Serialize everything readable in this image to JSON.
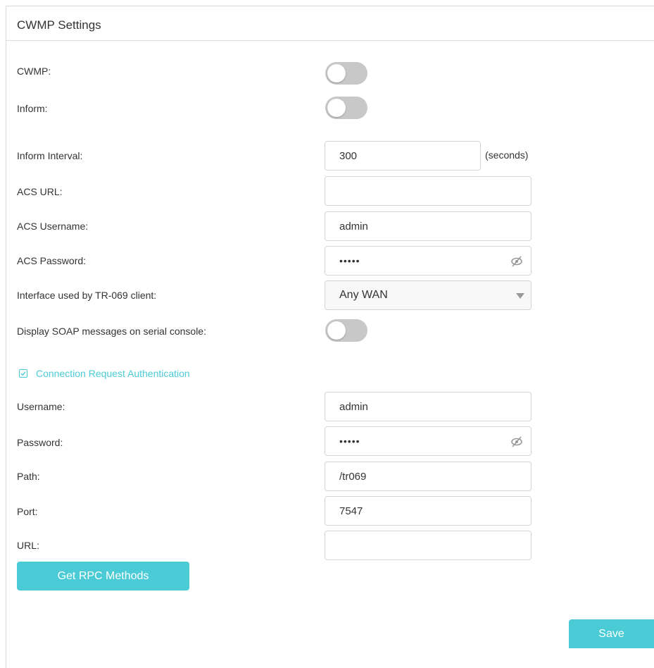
{
  "panel": {
    "title": "CWMP Settings"
  },
  "cwmp": {
    "label": "CWMP:",
    "enabled": false
  },
  "inform": {
    "label": "Inform:",
    "enabled": false
  },
  "inform_interval": {
    "label": "Inform Interval:",
    "value": "300",
    "unit": "(seconds)"
  },
  "acs_url": {
    "label": "ACS URL:",
    "value": ""
  },
  "acs_username": {
    "label": "ACS Username:",
    "value": "admin"
  },
  "acs_password": {
    "label": "ACS Password:",
    "masked": "•••••"
  },
  "interface": {
    "label": "Interface used by TR-069 client:",
    "selected": "Any WAN"
  },
  "soap": {
    "label": "Display SOAP messages on serial console:",
    "enabled": false
  },
  "conn_auth": {
    "label": "Connection Request Authentication",
    "checked": true,
    "accent_color": "#4acbd6"
  },
  "cr_username": {
    "label": "Username:",
    "value": "admin"
  },
  "cr_password": {
    "label": "Password:",
    "masked": "•••••"
  },
  "path": {
    "label": "Path:",
    "value": "/tr069"
  },
  "port": {
    "label": "Port:",
    "value": "7547"
  },
  "url": {
    "label": "URL:",
    "value": ""
  },
  "buttons": {
    "rpc": "Get RPC Methods",
    "save": "Save"
  },
  "icons": {
    "password_toggle": "eye-slash-icon",
    "dropdown": "chevron-down-icon",
    "checkbox": "checkmark-icon"
  }
}
